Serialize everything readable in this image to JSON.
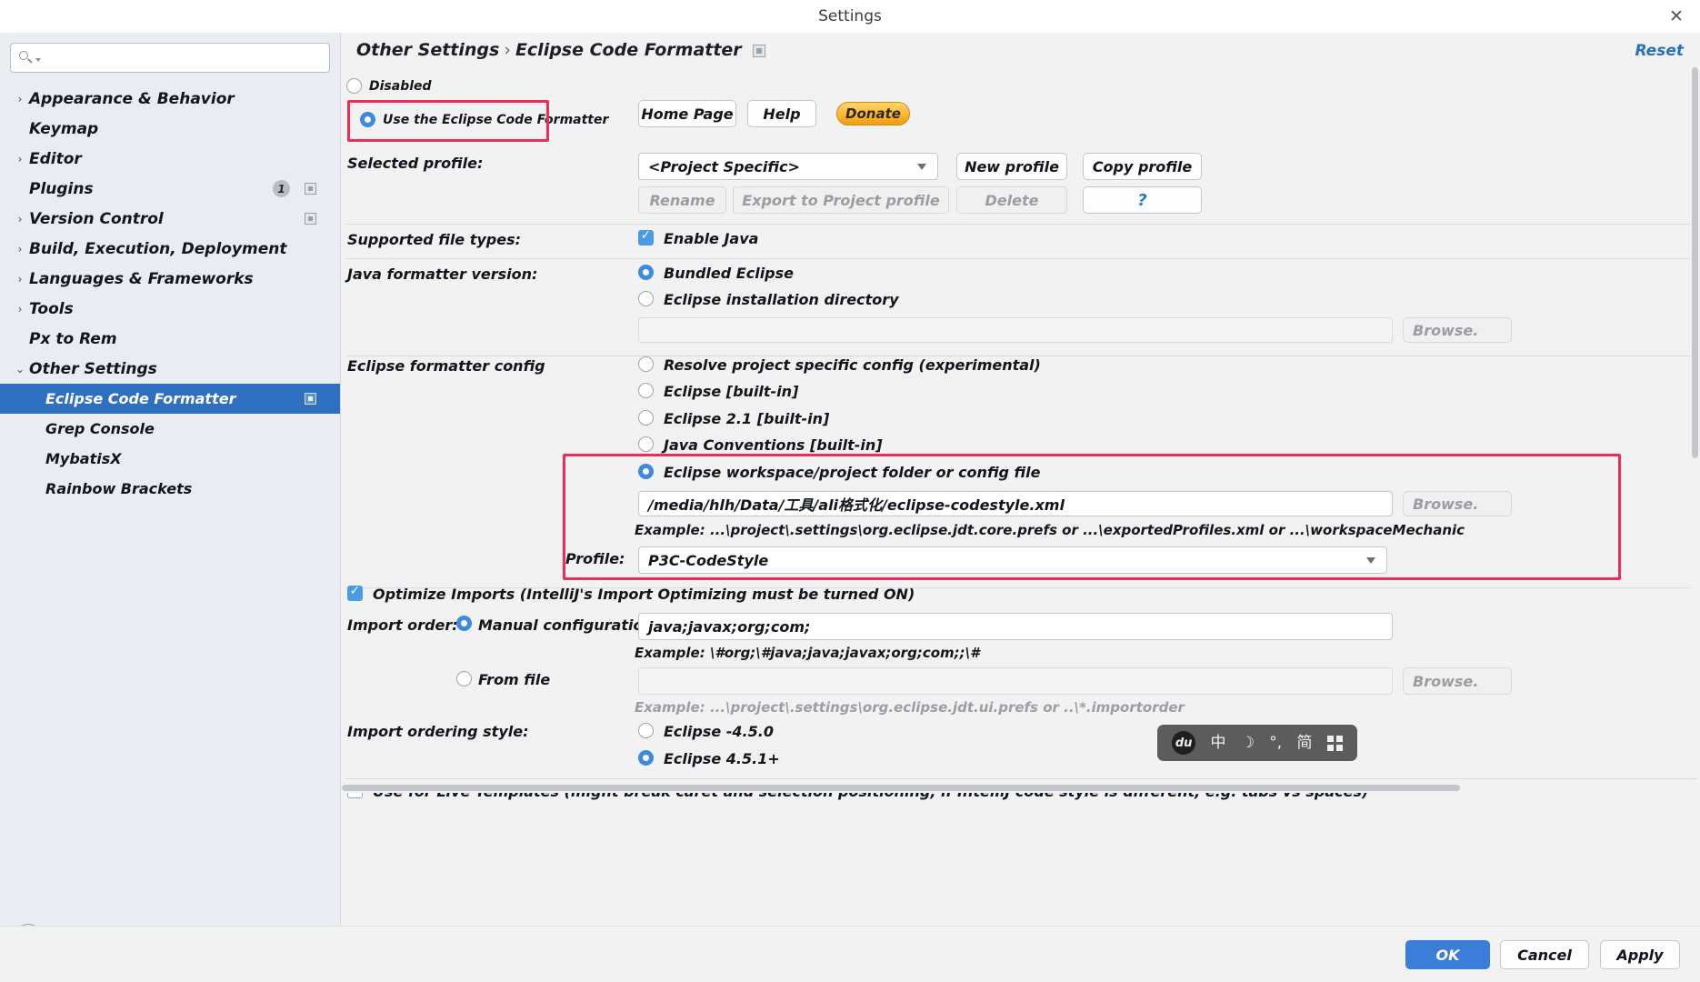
{
  "window": {
    "title": "Settings",
    "close_icon": "close-icon"
  },
  "sidebar": {
    "search": {
      "value": "",
      "placeholder": ""
    },
    "items": [
      {
        "label": "Appearance & Behavior",
        "arrow": "›",
        "indent": false,
        "selected": false,
        "badge": "",
        "icon": false
      },
      {
        "label": "Keymap",
        "arrow": "",
        "indent": false,
        "selected": false,
        "badge": "",
        "icon": false
      },
      {
        "label": "Editor",
        "arrow": "›",
        "indent": false,
        "selected": false,
        "badge": "",
        "icon": false
      },
      {
        "label": "Plugins",
        "arrow": "",
        "indent": false,
        "selected": false,
        "badge": "1",
        "icon": true
      },
      {
        "label": "Version Control",
        "arrow": "›",
        "indent": false,
        "selected": false,
        "badge": "",
        "icon": true
      },
      {
        "label": "Build, Execution, Deployment",
        "arrow": "›",
        "indent": false,
        "selected": false,
        "badge": "",
        "icon": false
      },
      {
        "label": "Languages & Frameworks",
        "arrow": "›",
        "indent": false,
        "selected": false,
        "badge": "",
        "icon": false
      },
      {
        "label": "Tools",
        "arrow": "›",
        "indent": false,
        "selected": false,
        "badge": "",
        "icon": false
      },
      {
        "label": "Px to Rem",
        "arrow": "",
        "indent": false,
        "selected": false,
        "badge": "",
        "icon": false
      },
      {
        "label": "Other Settings",
        "arrow": "⌄",
        "indent": false,
        "selected": false,
        "badge": "",
        "icon": false
      },
      {
        "label": "Eclipse Code Formatter",
        "arrow": "",
        "indent": true,
        "selected": true,
        "badge": "",
        "icon": true
      },
      {
        "label": "Grep Console",
        "arrow": "",
        "indent": true,
        "selected": false,
        "badge": "",
        "icon": false
      },
      {
        "label": "MybatisX",
        "arrow": "",
        "indent": true,
        "selected": false,
        "badge": "",
        "icon": false
      },
      {
        "label": "Rainbow Brackets",
        "arrow": "",
        "indent": true,
        "selected": false,
        "badge": "",
        "icon": false
      }
    ],
    "help_button": "?"
  },
  "header": {
    "breadcrumb_parent": "Other Settings",
    "breadcrumb_sep": "›",
    "breadcrumb_current": "Eclipse Code Formatter",
    "breadcrumb_icon": "settings-square-icon",
    "reset_label": "Reset"
  },
  "main": {
    "mode": {
      "disabled_label": "Disabled",
      "disabled_checked": false,
      "use_formatter_label": "Use the Eclipse Code Formatter",
      "use_formatter_checked": true
    },
    "links": {
      "home_page": "Home Page",
      "help": "Help",
      "donate": "Donate"
    },
    "profile": {
      "label": "Selected profile:",
      "selected": "<Project Specific>",
      "new_profile": "New profile",
      "copy_profile": "Copy profile",
      "rename": "Rename",
      "export": "Export to Project profile",
      "delete": "Delete",
      "question": "?"
    },
    "supported_file_types": {
      "label": "Supported file types:",
      "enable_java_label": "Enable Java",
      "enable_java_checked": true
    },
    "java_formatter_version": {
      "label": "Java formatter version:",
      "bundled_label": "Bundled Eclipse",
      "bundled_checked": true,
      "install_dir_label": "Eclipse installation directory",
      "install_dir_checked": false,
      "install_dir_value": "",
      "browse_label": "Browse."
    },
    "eclipse_formatter_config": {
      "label": "Eclipse formatter config",
      "options": [
        {
          "label": "Resolve project specific config (experimental)",
          "checked": false
        },
        {
          "label": "Eclipse [built-in]",
          "checked": false
        },
        {
          "label": "Eclipse 2.1 [built-in]",
          "checked": false
        },
        {
          "label": "Java Conventions [built-in]",
          "checked": false
        },
        {
          "label": "Eclipse workspace/project folder or config file",
          "checked": true
        }
      ],
      "config_path": "/media/hlh/Data/工具/ali格式化/eclipse-codestyle.xml",
      "config_example": "Example: ...\\project\\.settings\\org.eclipse.jdt.core.prefs or ...\\exportedProfiles.xml or ...\\workspaceMechanic",
      "profile_label": "Profile:",
      "profile_value": "P3C-CodeStyle",
      "browse_label": "Browse."
    },
    "optimize_imports": {
      "checked": true,
      "label": "Optimize Imports  (IntelliJ's Import Optimizing must be turned ON)"
    },
    "import_order": {
      "label": "Import order:",
      "manual_label": "Manual configuration",
      "manual_checked": true,
      "manual_value": "java;javax;org;com;",
      "manual_example": "Example: \\#org;\\#java;java;javax;org;com;;\\#",
      "from_file_label": "From file",
      "from_file_checked": false,
      "from_file_value": "",
      "from_file_example": "Example: ...\\project\\.settings\\org.eclipse.jdt.ui.prefs or ..\\*.importorder",
      "browse_label": "Browse."
    },
    "import_ordering_style": {
      "label": "Import ordering style:",
      "options": [
        {
          "label": "Eclipse -4.5.0",
          "checked": false
        },
        {
          "label": "Eclipse 4.5.1+",
          "checked": true
        }
      ]
    },
    "live_templates": {
      "checked": false,
      "label": "Use for Live Templates (might break caret and selection positioning, if IntelliJ code style is different, e.g. tabs vs spaces)"
    }
  },
  "ime_toolbar": {
    "logo": "du",
    "chinese_mode": "中",
    "moon": "☽",
    "punctuation": "°,",
    "simplified": "简",
    "keyboard": "keyboard-grid-icon"
  },
  "footer": {
    "ok": "OK",
    "cancel": "Cancel",
    "apply": "Apply"
  },
  "colors": {
    "accent_blue": "#3b7dd8",
    "highlight_red": "#ef2b56",
    "selection_blue": "#2f6fc0",
    "link_blue": "#2a6fbd"
  }
}
